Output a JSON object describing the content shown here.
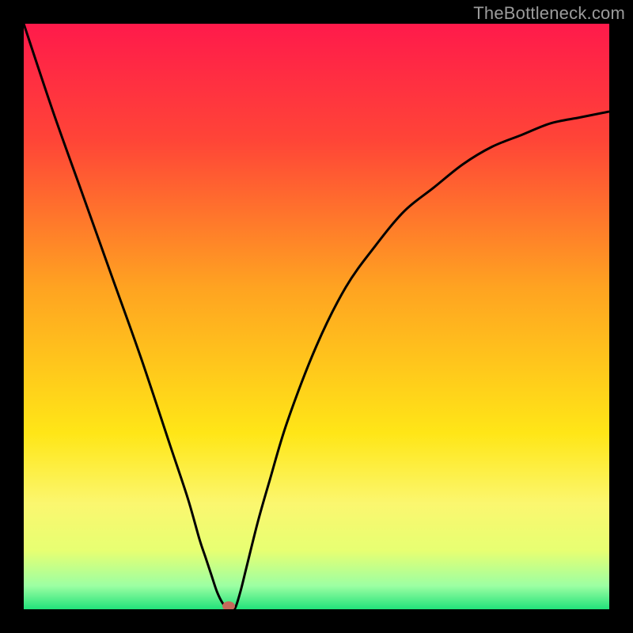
{
  "attribution": "TheBottleneck.com",
  "marker": {
    "x_pct": 35,
    "y_pct": 100
  },
  "chart_data": {
    "type": "line",
    "title": "",
    "xlabel": "",
    "ylabel": "",
    "xlim": [
      0,
      100
    ],
    "ylim": [
      0,
      100
    ],
    "grid": false,
    "legend": false,
    "background_gradient_stops": [
      {
        "pct": 0,
        "color": "#ff1a4b"
      },
      {
        "pct": 20,
        "color": "#ff4537"
      },
      {
        "pct": 45,
        "color": "#ffa321"
      },
      {
        "pct": 70,
        "color": "#ffe617"
      },
      {
        "pct": 82,
        "color": "#fbf76f"
      },
      {
        "pct": 90,
        "color": "#e7ff72"
      },
      {
        "pct": 96,
        "color": "#9cffa3"
      },
      {
        "pct": 100,
        "color": "#22e27a"
      }
    ],
    "series": [
      {
        "name": "bottleneck-curve",
        "color": "#000000",
        "x": [
          0,
          5,
          10,
          15,
          20,
          25,
          28,
          30,
          31,
          32,
          33,
          34,
          35,
          36,
          37,
          38,
          40,
          42,
          45,
          50,
          55,
          60,
          65,
          70,
          75,
          80,
          85,
          90,
          95,
          100
        ],
        "y": [
          100,
          85,
          71,
          57,
          43,
          28,
          19,
          12,
          9,
          6,
          3,
          1,
          0,
          0,
          3,
          7,
          15,
          22,
          32,
          45,
          55,
          62,
          68,
          72,
          76,
          79,
          81,
          83,
          84,
          85
        ]
      }
    ],
    "annotations": [
      {
        "type": "marker",
        "x": 35,
        "y": 0,
        "shape": "ellipse",
        "color": "#c46a5b"
      }
    ]
  }
}
